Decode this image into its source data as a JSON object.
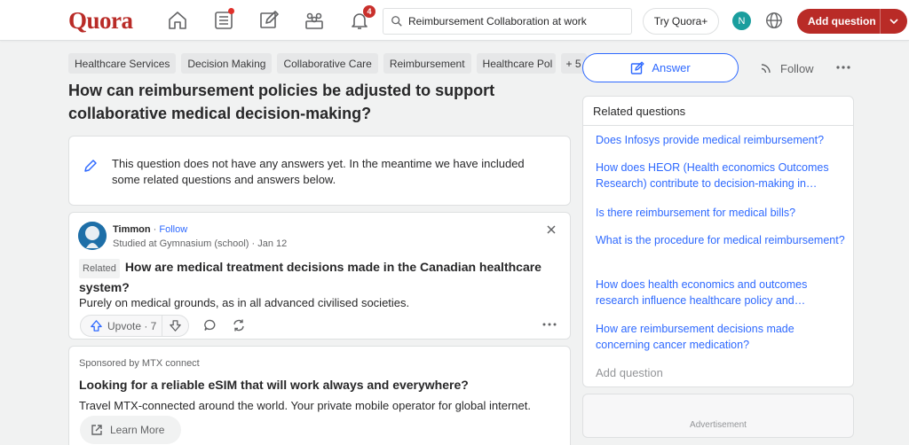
{
  "header": {
    "logo": "Quora",
    "notifications_count": "4",
    "search_value": "Reimbursement Collaboration at work",
    "try_label": "Try Quora+",
    "avatar_initial": "N",
    "add_question_label": "Add question"
  },
  "tags": [
    "Healthcare Services",
    "Decision Making",
    "Collaborative Care",
    "Reimbursement",
    "Healthcare Pol",
    "+ 5"
  ],
  "question": {
    "title": "How can reimbursement policies be adjusted to support collaborative medical decision-making?"
  },
  "info_notice": "This question does not have any answers yet. In the meantime we have included some related questions and answers below.",
  "answer_card": {
    "author": "Timmon",
    "separator": "·",
    "follow_label": "Follow",
    "credential": "Studied at Gymnasium (school) · Jan 12",
    "related_label": "Related",
    "question": "How are medical treatment decisions made in the Canadian healthcare system?",
    "text": "Purely on medical grounds, as in all advanced civilised societies.",
    "upvote_label": "Upvote · 7"
  },
  "sponsored": {
    "by": "Sponsored by MTX connect",
    "title": "Looking for a reliable eSIM that will work always and everywhere?",
    "text": "Travel MTX-connected around the world. Your private mobile operator for global internet.",
    "cta": "Learn More"
  },
  "actions": {
    "answer_label": "Answer",
    "follow_label": "Follow"
  },
  "related": {
    "heading": "Related questions",
    "items": [
      "Does Infosys provide medical reimbursement?",
      "How does HEOR (Health economics Outcomes Research) contribute to decision-making in…",
      "Is there reimbursement for medical bills?",
      "What is the procedure for medical reimbursement?",
      "How does health economics and outcomes research influence healthcare policy and…",
      "How are reimbursement decisions made concerning cancer medication?"
    ],
    "add_question": "Add question"
  },
  "ad_label": "Advertisement",
  "colors": {
    "brand": "#b92b27",
    "link": "#2e69ff",
    "avatar": "#1a9e9e"
  }
}
